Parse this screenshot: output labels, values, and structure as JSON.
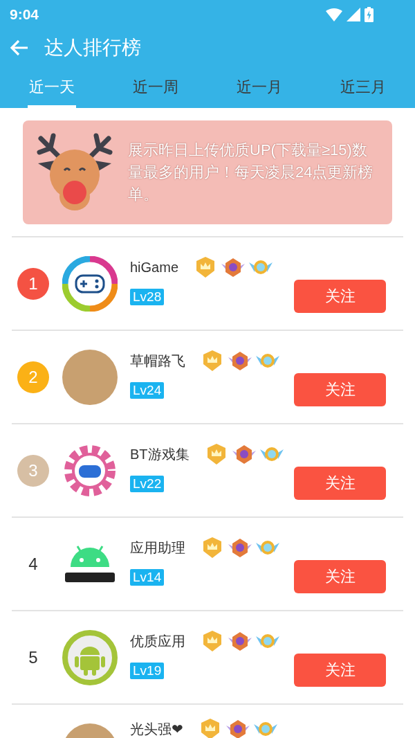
{
  "status_bar": {
    "time": "9:04"
  },
  "app_bar": {
    "title": "达人排行榜"
  },
  "tabs": [
    {
      "label": "近一天",
      "selected": true
    },
    {
      "label": "近一周",
      "selected": false
    },
    {
      "label": "近一月",
      "selected": false
    },
    {
      "label": "近三月",
      "selected": false
    }
  ],
  "notice": {
    "text": "展示昨日上传优质UP(下载量≥15)数量最多的用户！每天凌晨24点更新榜单。"
  },
  "ranking": [
    {
      "rank": "1",
      "kind": "medal",
      "color": "#f45243",
      "avatar": {
        "kind": "gamepad"
      },
      "name": "hiGame",
      "level_tag": "Lv28",
      "button": "关注"
    },
    {
      "rank": "2",
      "kind": "medal",
      "color": "#fbb116",
      "avatar": {
        "kind": "photo"
      },
      "name": "草帽路飞",
      "level_tag": "Lv24",
      "button": "关注"
    },
    {
      "rank": "3",
      "kind": "medal",
      "color": "#d7bfa4",
      "avatar": {
        "kind": "gear"
      },
      "name": "BT游戏集",
      "level_tag": "Lv22",
      "button": "关注"
    },
    {
      "rank": "4",
      "kind": "plain",
      "avatar": {
        "kind": "android-text"
      },
      "name": "应用助理",
      "level_tag": "Lv14",
      "button": "关注"
    },
    {
      "rank": "5",
      "kind": "plain",
      "avatar": {
        "kind": "android-circle"
      },
      "name": "优质应用",
      "level_tag": "Lv19",
      "button": "关注"
    },
    {
      "kind": "partial",
      "avatar": {
        "kind": "photo"
      },
      "name": "光头强❤"
    }
  ]
}
